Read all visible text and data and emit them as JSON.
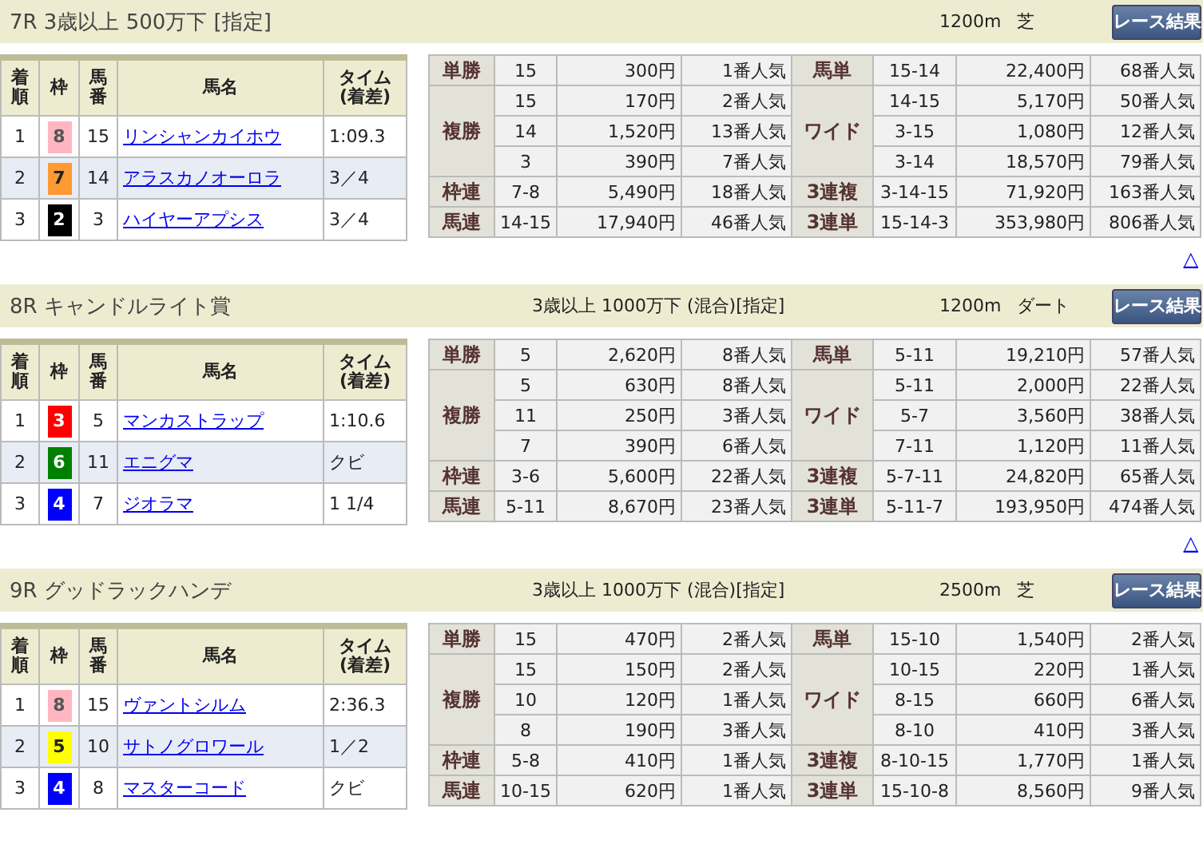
{
  "races": [
    {
      "title": "7R 3歳以上 500万下 [指定]",
      "distance": "1200m",
      "surface": "芝",
      "button": "レース結果",
      "columns": [
        "着順",
        "枠",
        "馬番",
        "馬名",
        "タイム\n(着差)"
      ],
      "results": [
        {
          "rank": "1",
          "bracket": "8",
          "color": "#ffb6c1",
          "number": "15",
          "horse": "リンシャンカイホウ",
          "time": "1:09.3"
        },
        {
          "rank": "2",
          "bracket": "7",
          "color": "#ff9933",
          "number": "14",
          "horse": "アラスカノオーロラ",
          "time": "3／4"
        },
        {
          "rank": "3",
          "bracket": "2",
          "color": "#000000",
          "number": "3",
          "horse": "ハイヤーアプシス",
          "time": "3／4"
        }
      ],
      "payouts": [
        {
          "left": {
            "label": "単勝",
            "entries": [
              {
                "combo": "15",
                "payout": "300円",
                "popularity": "1番人気"
              }
            ]
          },
          "right": {
            "label": "馬単",
            "entries": [
              {
                "combo": "15-14",
                "payout": "22,400円",
                "popularity": "68番人気"
              }
            ]
          }
        },
        {
          "left": {
            "label": "複勝",
            "entries": [
              {
                "combo": "15",
                "payout": "170円",
                "popularity": "2番人気"
              },
              {
                "combo": "14",
                "payout": "1,520円",
                "popularity": "13番人気"
              },
              {
                "combo": "3",
                "payout": "390円",
                "popularity": "7番人気"
              }
            ]
          },
          "right": {
            "label": "ワイド",
            "entries": [
              {
                "combo": "14-15",
                "payout": "5,170円",
                "popularity": "50番人気"
              },
              {
                "combo": "3-15",
                "payout": "1,080円",
                "popularity": "12番人気"
              },
              {
                "combo": "3-14",
                "payout": "18,570円",
                "popularity": "79番人気"
              }
            ]
          }
        },
        {
          "left": {
            "label": "枠連",
            "entries": [
              {
                "combo": "7-8",
                "payout": "5,490円",
                "popularity": "18番人気"
              }
            ]
          },
          "right": {
            "label": "3連複",
            "entries": [
              {
                "combo": "3-14-15",
                "payout": "71,920円",
                "popularity": "163番人気"
              }
            ]
          }
        },
        {
          "left": {
            "label": "馬連",
            "entries": [
              {
                "combo": "14-15",
                "payout": "17,940円",
                "popularity": "46番人気"
              }
            ]
          },
          "right": {
            "label": "3連単",
            "entries": [
              {
                "combo": "15-14-3",
                "payout": "353,980円",
                "popularity": "806番人気"
              }
            ]
          }
        }
      ],
      "top_link": "△"
    },
    {
      "title": "8R キャンドルライト賞",
      "conditions": "3歳以上 1000万下 (混合)[指定]",
      "distance": "1200m",
      "surface": "ダート",
      "button": "レース結果",
      "columns": [
        "着順",
        "枠",
        "馬番",
        "馬名",
        "タイム\n(着差)"
      ],
      "results": [
        {
          "rank": "1",
          "bracket": "3",
          "color": "#ff0000",
          "number": "5",
          "horse": "マンカストラップ",
          "time": "1:10.6"
        },
        {
          "rank": "2",
          "bracket": "6",
          "color": "#008000",
          "number": "11",
          "horse": "エニグマ",
          "time": "クビ"
        },
        {
          "rank": "3",
          "bracket": "4",
          "color": "#0000ff",
          "number": "7",
          "horse": "ジオラマ",
          "time": "1 1/4"
        }
      ],
      "payouts": [
        {
          "left": {
            "label": "単勝",
            "entries": [
              {
                "combo": "5",
                "payout": "2,620円",
                "popularity": "8番人気"
              }
            ]
          },
          "right": {
            "label": "馬単",
            "entries": [
              {
                "combo": "5-11",
                "payout": "19,210円",
                "popularity": "57番人気"
              }
            ]
          }
        },
        {
          "left": {
            "label": "複勝",
            "entries": [
              {
                "combo": "5",
                "payout": "630円",
                "popularity": "8番人気"
              },
              {
                "combo": "11",
                "payout": "250円",
                "popularity": "3番人気"
              },
              {
                "combo": "7",
                "payout": "390円",
                "popularity": "6番人気"
              }
            ]
          },
          "right": {
            "label": "ワイド",
            "entries": [
              {
                "combo": "5-11",
                "payout": "2,000円",
                "popularity": "22番人気"
              },
              {
                "combo": "5-7",
                "payout": "3,560円",
                "popularity": "38番人気"
              },
              {
                "combo": "7-11",
                "payout": "1,120円",
                "popularity": "11番人気"
              }
            ]
          }
        },
        {
          "left": {
            "label": "枠連",
            "entries": [
              {
                "combo": "3-6",
                "payout": "5,600円",
                "popularity": "22番人気"
              }
            ]
          },
          "right": {
            "label": "3連複",
            "entries": [
              {
                "combo": "5-7-11",
                "payout": "24,820円",
                "popularity": "65番人気"
              }
            ]
          }
        },
        {
          "left": {
            "label": "馬連",
            "entries": [
              {
                "combo": "5-11",
                "payout": "8,670円",
                "popularity": "23番人気"
              }
            ]
          },
          "right": {
            "label": "3連単",
            "entries": [
              {
                "combo": "5-11-7",
                "payout": "193,950円",
                "popularity": "474番人気"
              }
            ]
          }
        }
      ],
      "top_link": "△"
    },
    {
      "title": "9R グッドラックハンデ",
      "conditions": "3歳以上 1000万下 (混合)[指定]",
      "distance": "2500m",
      "surface": "芝",
      "button": "レース結果",
      "columns": [
        "着順",
        "枠",
        "馬番",
        "馬名",
        "タイム\n(着差)"
      ],
      "results": [
        {
          "rank": "1",
          "bracket": "8",
          "color": "#ffb6c1",
          "number": "15",
          "horse": "ヴァントシルム",
          "time": "2:36.3"
        },
        {
          "rank": "2",
          "bracket": "5",
          "color": "#ffff00",
          "number": "10",
          "horse": "サトノグロワール",
          "time": "1／2"
        },
        {
          "rank": "3",
          "bracket": "4",
          "color": "#0000ff",
          "number": "8",
          "horse": "マスターコード",
          "time": "クビ"
        }
      ],
      "payouts": [
        {
          "left": {
            "label": "単勝",
            "entries": [
              {
                "combo": "15",
                "payout": "470円",
                "popularity": "2番人気"
              }
            ]
          },
          "right": {
            "label": "馬単",
            "entries": [
              {
                "combo": "15-10",
                "payout": "1,540円",
                "popularity": "2番人気"
              }
            ]
          }
        },
        {
          "left": {
            "label": "複勝",
            "entries": [
              {
                "combo": "15",
                "payout": "150円",
                "popularity": "2番人気"
              },
              {
                "combo": "10",
                "payout": "120円",
                "popularity": "1番人気"
              },
              {
                "combo": "8",
                "payout": "190円",
                "popularity": "3番人気"
              }
            ]
          },
          "right": {
            "label": "ワイド",
            "entries": [
              {
                "combo": "10-15",
                "payout": "220円",
                "popularity": "1番人気"
              },
              {
                "combo": "8-15",
                "payout": "660円",
                "popularity": "6番人気"
              },
              {
                "combo": "8-10",
                "payout": "410円",
                "popularity": "3番人気"
              }
            ]
          }
        },
        {
          "left": {
            "label": "枠連",
            "entries": [
              {
                "combo": "5-8",
                "payout": "410円",
                "popularity": "1番人気"
              }
            ]
          },
          "right": {
            "label": "3連複",
            "entries": [
              {
                "combo": "8-10-15",
                "payout": "1,770円",
                "popularity": "1番人気"
              }
            ]
          }
        },
        {
          "left": {
            "label": "馬連",
            "entries": [
              {
                "combo": "10-15",
                "payout": "620円",
                "popularity": "1番人気"
              }
            ]
          },
          "right": {
            "label": "3連単",
            "entries": [
              {
                "combo": "15-10-8",
                "payout": "8,560円",
                "popularity": "9番人気"
              }
            ]
          }
        }
      ]
    }
  ]
}
